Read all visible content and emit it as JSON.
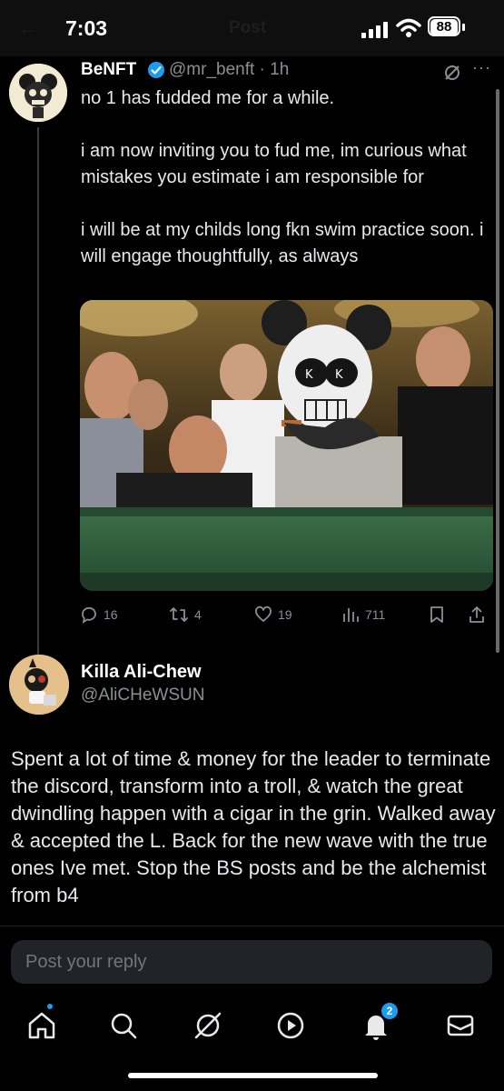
{
  "status_bar": {
    "time": "7:03",
    "battery": "88",
    "ghost_title": "Post",
    "ghost_back": "←"
  },
  "tweet": {
    "author_name": "BeNFT",
    "author_handle": "@mr_benft · 1h",
    "text": "no 1 has fudded me for a while.\n\ni am now inviting you to fud me, im curious what mistakes you estimate i am responsible for\n\ni will be at my childs long fkn swim practice soon.  i will engage thoughtfully, as always",
    "more": "···",
    "actions": {
      "replies": "16",
      "reposts": "4",
      "likes": "19",
      "views": "711"
    }
  },
  "reply": {
    "author_name": "Killa Ali-Chew",
    "author_handle": "@AliCHeWSUN",
    "text": "Spent a lot of time & money for the leader to terminate the discord, transform into a troll, & watch the great dwindling happen with a cigar in the grin. Walked away & accepted the L. Back for the new wave with the true ones Ive met. Stop the BS posts and be the alchemist from b4"
  },
  "composer": {
    "placeholder": "Post your reply"
  },
  "bottom_nav": {
    "items": [
      "home-icon",
      "search-icon",
      "grok-icon",
      "video-icon",
      "notifications-icon",
      "messages-icon"
    ],
    "notification_count": "2"
  },
  "colors": {
    "accent": "#1d9bf0",
    "background": "#000000",
    "muted_text": "#8b8f93",
    "felt_green": "#2f5a3a"
  }
}
